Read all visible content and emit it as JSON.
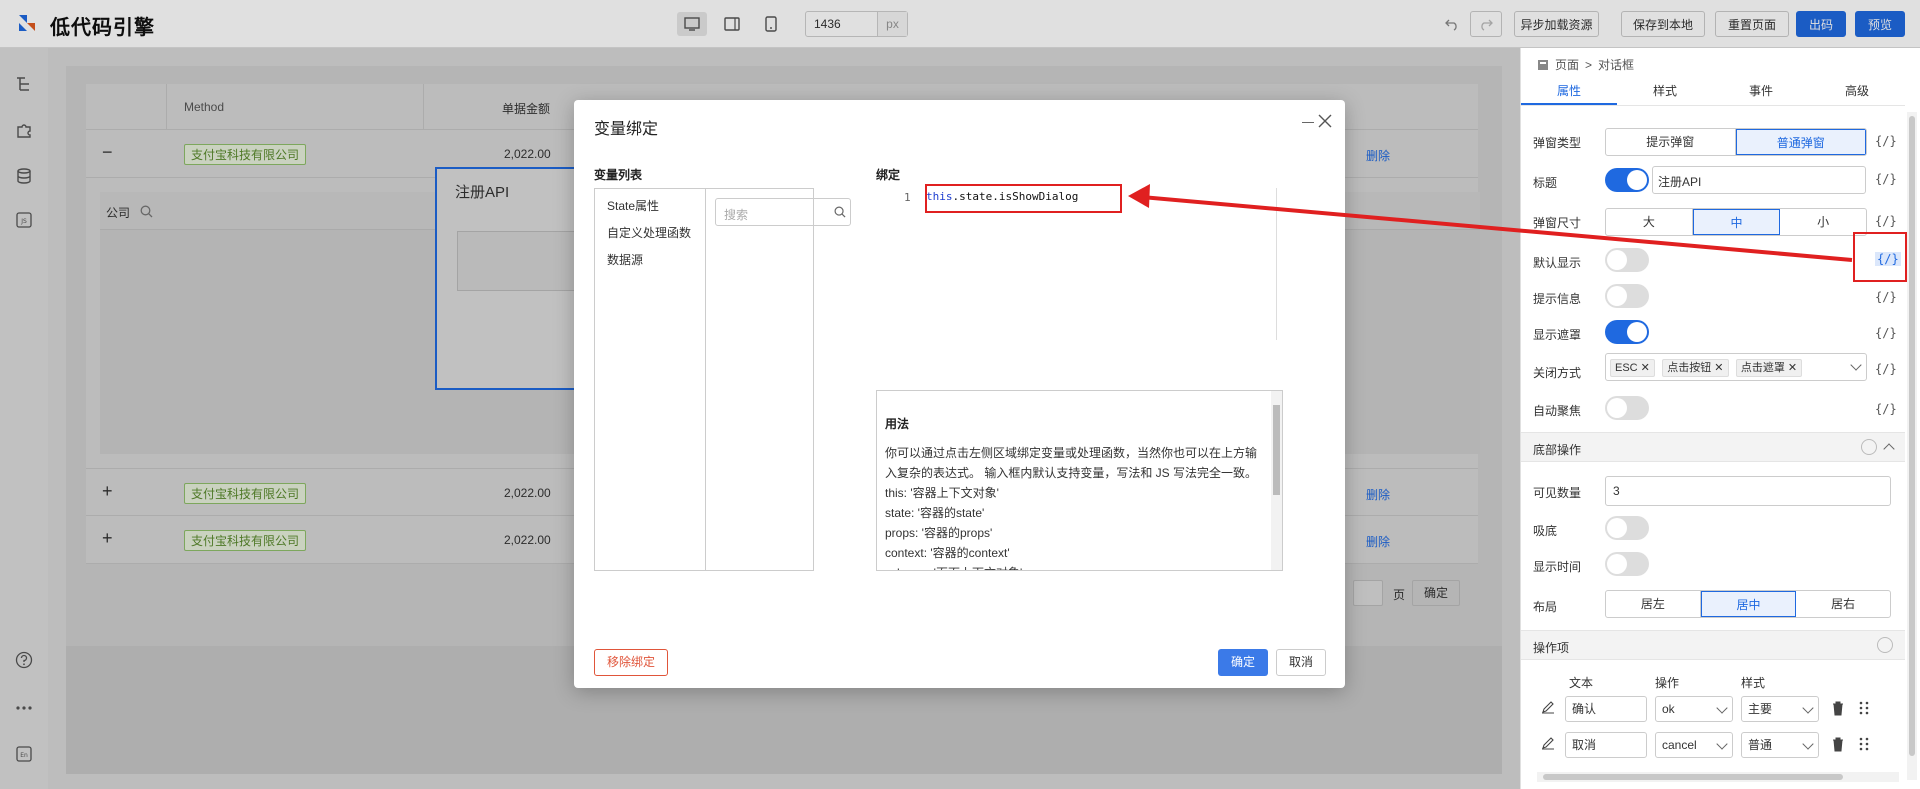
{
  "app": {
    "title": "低代码引擎"
  },
  "toolbar": {
    "width_value": "1436",
    "width_unit": "px",
    "async_load_label": "异步加载资源",
    "save_local_label": "保存到本地",
    "reset_page_label": "重置页面",
    "export_label": "出码",
    "preview_label": "预览"
  },
  "canvas": {
    "table": {
      "header": {
        "method": "Method",
        "amount": "单据金额"
      },
      "rows": [
        {
          "toggle": "−",
          "company": "支付宝科技有限公司",
          "amount": "2,022.00",
          "delete": "删除"
        },
        {
          "toggle": "+",
          "company": "支付宝科技有限公司",
          "amount": "2,022.00",
          "delete": "删除"
        },
        {
          "toggle": "+",
          "company": "支付宝科技有限公司",
          "amount": "2,022.00",
          "delete": "删除"
        }
      ],
      "expanded_label": "公司",
      "pager_suffix": "页",
      "pager_confirm": "确定"
    },
    "inner_dialog_title": "注册API"
  },
  "modal": {
    "title": "变量绑定",
    "var_list_label": "变量列表",
    "var_items": [
      "State属性",
      "自定义处理函数",
      "数据源"
    ],
    "search_placeholder": "搜索",
    "binding_label": "绑定",
    "line_number": "1",
    "code_this": "this",
    "code_rest": ".state.isShowDialog",
    "usage_title": "用法",
    "usage_lines": [
      "你可以通过点击左侧区域绑定变量或处理函数，当然你也可以在上方输",
      "入复杂的表达式。 输入框内默认支持变量，写法和 JS 写法完全一致。",
      "this: '容器上下文对象'",
      "state: '容器的state'",
      "props: '容器的props'",
      "context: '容器的context'",
      "schema: '页面上下文对象'"
    ],
    "remove_binding_label": "移除绑定",
    "confirm_label": "确定",
    "cancel_label": "取消"
  },
  "panel": {
    "breadcrumb": {
      "root": "页面",
      "sep": ">",
      "current": "对话框"
    },
    "tabs": [
      "属性",
      "样式",
      "事件",
      "高级"
    ],
    "var_btn": "{/}",
    "props": {
      "dialog_type": {
        "label": "弹窗类型",
        "options": [
          "提示弹窗",
          "普通弹窗"
        ],
        "selected": "普通弹窗"
      },
      "title": {
        "label": "标题",
        "value": "注册API"
      },
      "size": {
        "label": "弹窗尺寸",
        "options": [
          "大",
          "中",
          "小"
        ],
        "selected": "中"
      },
      "default_show": {
        "label": "默认显示"
      },
      "tip_info": {
        "label": "提示信息"
      },
      "show_mask": {
        "label": "显示遮罩"
      },
      "close_mode": {
        "label": "关闭方式",
        "chips": [
          "ESC",
          "点击按钮",
          "点击遮罩"
        ]
      },
      "auto_focus": {
        "label": "自动聚焦"
      }
    },
    "footer_section": {
      "title": "底部操作",
      "visible_count": {
        "label": "可见数量",
        "value": "3"
      },
      "sticky": {
        "label": "吸底"
      },
      "show_time": {
        "label": "显示时间"
      },
      "layout": {
        "label": "布局",
        "options": [
          "居左",
          "居中",
          "居右"
        ],
        "selected": "居中"
      }
    },
    "actions_section": {
      "title": "操作项",
      "columns": [
        "文本",
        "操作",
        "样式"
      ],
      "rows": [
        {
          "text": "确认",
          "action": "ok",
          "style": "主要"
        },
        {
          "text": "取消",
          "action": "cancel",
          "style": "普通"
        }
      ]
    }
  },
  "colors": {
    "primary": "#1f69e0",
    "highlight_red": "#e02020",
    "tag_green": "#5a8a2d"
  }
}
